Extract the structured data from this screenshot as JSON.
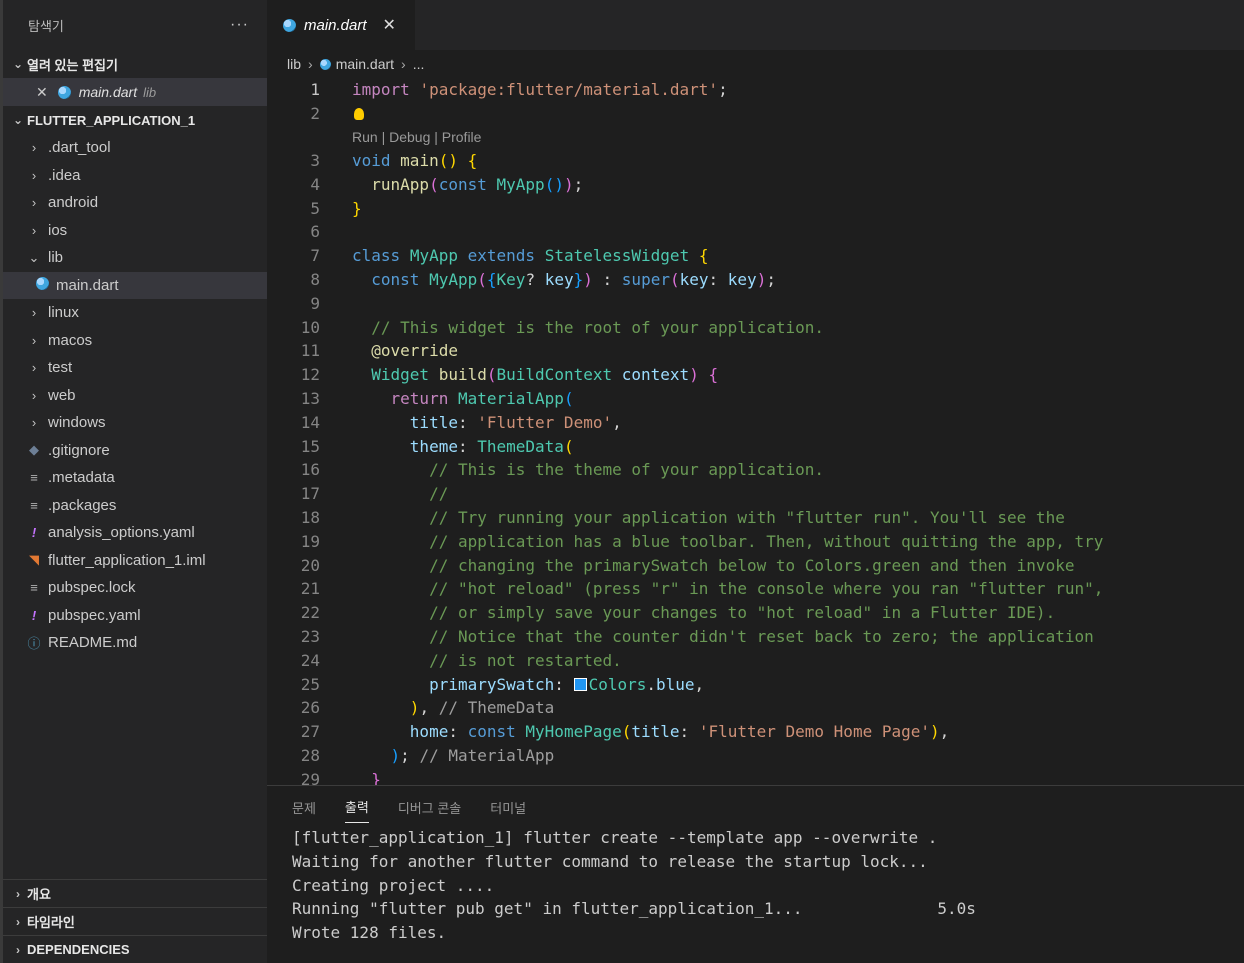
{
  "sidebar": {
    "title": "탐색기",
    "more": "···",
    "open_editors_title": "열려 있는 편집기",
    "open_editor": {
      "name": "main.dart",
      "desc": "lib"
    },
    "project_title": "FLUTTER_APPLICATION_1",
    "items": [
      {
        "label": ".dart_tool",
        "icon": "chevron-right"
      },
      {
        "label": ".idea",
        "icon": "chevron-right"
      },
      {
        "label": "android",
        "icon": "chevron-right"
      },
      {
        "label": "ios",
        "icon": "chevron-right"
      },
      {
        "label": "lib",
        "icon": "chevron-down"
      },
      {
        "label": "main.dart",
        "icon": "dart-icon"
      },
      {
        "label": "linux",
        "icon": "chevron-right"
      },
      {
        "label": "macos",
        "icon": "chevron-right"
      },
      {
        "label": "test",
        "icon": "chevron-right"
      },
      {
        "label": "web",
        "icon": "chevron-right"
      },
      {
        "label": "windows",
        "icon": "chevron-right"
      },
      {
        "label": ".gitignore",
        "icon": "git-icon"
      },
      {
        "label": ".metadata",
        "icon": "file-lines-icon"
      },
      {
        "label": ".packages",
        "icon": "file-lines-icon"
      },
      {
        "label": "analysis_options.yaml",
        "icon": "yaml-icon"
      },
      {
        "label": "flutter_application_1.iml",
        "icon": "rss-icon"
      },
      {
        "label": "pubspec.lock",
        "icon": "file-lines-icon"
      },
      {
        "label": "pubspec.yaml",
        "icon": "yaml-icon"
      },
      {
        "label": "README.md",
        "icon": "info-icon"
      }
    ],
    "bottom_sections": [
      "개요",
      "타임라인",
      "DEPENDENCIES"
    ]
  },
  "editor": {
    "tab": {
      "label": "main.dart",
      "close": "✕"
    },
    "breadcrumb": {
      "folder": "lib",
      "file": "main.dart",
      "more": "..."
    },
    "codelens": "Run | Debug | Profile",
    "line_numbers": [
      "1",
      "2",
      "3",
      "4",
      "5",
      "6",
      "7",
      "8",
      "9",
      "10",
      "11",
      "12",
      "13",
      "14",
      "15",
      "16",
      "17",
      "18",
      "19",
      "20",
      "21",
      "22",
      "23",
      "24",
      "25",
      "26",
      "27",
      "28",
      "29"
    ]
  },
  "panel": {
    "tabs": [
      "문제",
      "출력",
      "디버그 콘솔",
      "터미널"
    ],
    "active_tab": "출력",
    "output": [
      "[flutter_application_1] flutter create --template app --overwrite .",
      "Waiting for another flutter command to release the startup lock...",
      "Creating project ....",
      "Running \"flutter pub get\" in flutter_application_1...              5.0s",
      "Wrote 128 files."
    ]
  },
  "colors": {
    "swatch_blue": "#2196f3",
    "keyword": "#569cd6",
    "string": "#ce9178",
    "comment": "#6a9955",
    "type": "#4ec9b0"
  }
}
